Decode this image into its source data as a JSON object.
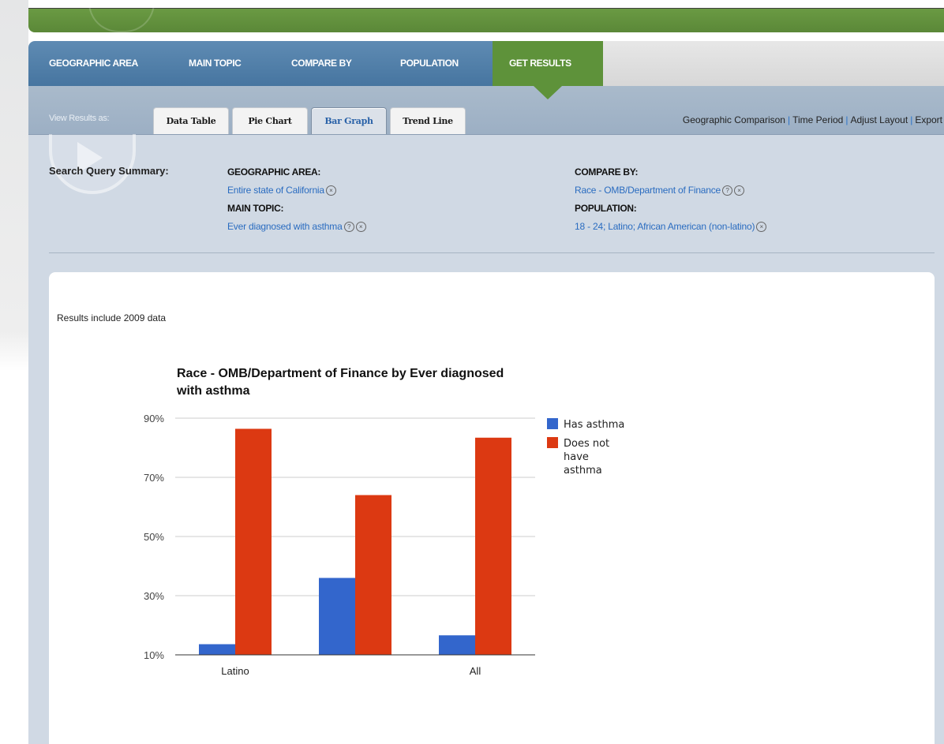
{
  "nav": {
    "items": [
      "GEOGRAPHIC AREA",
      "MAIN TOPIC",
      "COMPARE BY",
      "POPULATION"
    ],
    "active": "GET RESULTS"
  },
  "view": {
    "label": "View Results as:",
    "tabs": [
      "Data Table",
      "Pie Chart",
      "Bar Graph",
      "Trend Line"
    ],
    "active_tab": "Bar Graph"
  },
  "links": [
    "Geographic Comparison",
    "Time Period",
    "Adjust Layout",
    "Export"
  ],
  "query": {
    "label": "Search Query Summary:",
    "geo_head": "GEOGRAPHIC AREA:",
    "geo_val": "Entire state of California",
    "topic_head": "MAIN TOPIC:",
    "topic_val": "Ever diagnosed with asthma",
    "compare_head": "COMPARE BY:",
    "compare_val": "Race - OMB/Department of Finance",
    "pop_head": "POPULATION:",
    "pop_val": "18 - 24; Latino; African American (non-latino)"
  },
  "results_note": "Results include 2009 data",
  "chart_data": {
    "type": "bar",
    "title": "Race - OMB/Department of Finance by Ever diagnosed with asthma",
    "categories": [
      "Latino",
      "",
      "All"
    ],
    "series": [
      {
        "name": "Has asthma",
        "color": "#3366cc",
        "values": [
          13.6,
          36.0,
          16.6
        ]
      },
      {
        "name": "Does not have asthma",
        "color": "#dc3912",
        "values": [
          86.4,
          64.0,
          83.4
        ]
      }
    ],
    "yticks": [
      "90%",
      "70%",
      "50%",
      "30%",
      "10%"
    ],
    "ylim": [
      10,
      90
    ],
    "grid": true,
    "legend": "right"
  }
}
